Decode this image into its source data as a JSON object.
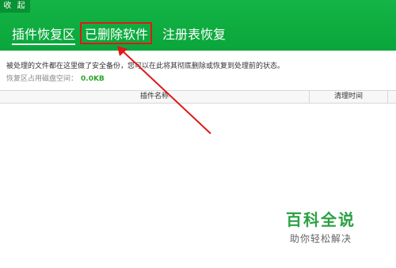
{
  "header": {
    "collapse_label": "收 起",
    "tabs": [
      {
        "label": "插件恢复区"
      },
      {
        "label": "已删除软件"
      },
      {
        "label": "注册表恢复"
      }
    ]
  },
  "info": {
    "description": "被处理的文件都在这里做了安全备份，您可以在此将其彻底删除或恢复到处理前的状态。",
    "space_label": "恢复区占用磁盘空间：",
    "space_value": "0.0KB"
  },
  "table": {
    "columns": [
      "插件名称",
      "清理时间"
    ],
    "rows": []
  },
  "watermark": {
    "title": "百科全说",
    "subtitle": "助你轻松解决"
  },
  "colors": {
    "header_green": "#14b446",
    "highlight_red": "#e01818",
    "value_green": "#2aa52c"
  }
}
